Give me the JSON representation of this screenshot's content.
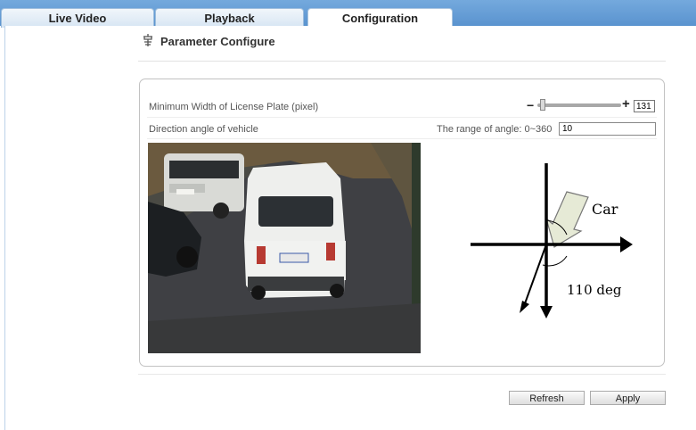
{
  "tabs": [
    {
      "label": "Live Video"
    },
    {
      "label": "Playback"
    },
    {
      "label": "Configuration",
      "active": true
    }
  ],
  "header": {
    "title": "Parameter Configure",
    "icon": "settings-gear-icon"
  },
  "settings": {
    "min_width_label": "Minimum Width of License Plate (pixel)",
    "min_width_value": "131",
    "minus": "−",
    "plus": "+",
    "direction_label": "Direction angle of vehicle",
    "angle_range_label": "The range of angle: 0~360",
    "angle_value": "10"
  },
  "diagram": {
    "car_label": "Car",
    "angle_label": "110 deg"
  },
  "buttons": {
    "refresh": "Refresh",
    "apply": "Apply"
  },
  "colors": {
    "tab_bar": "#5a93cf",
    "arrow_fill": "#e6ead6"
  }
}
